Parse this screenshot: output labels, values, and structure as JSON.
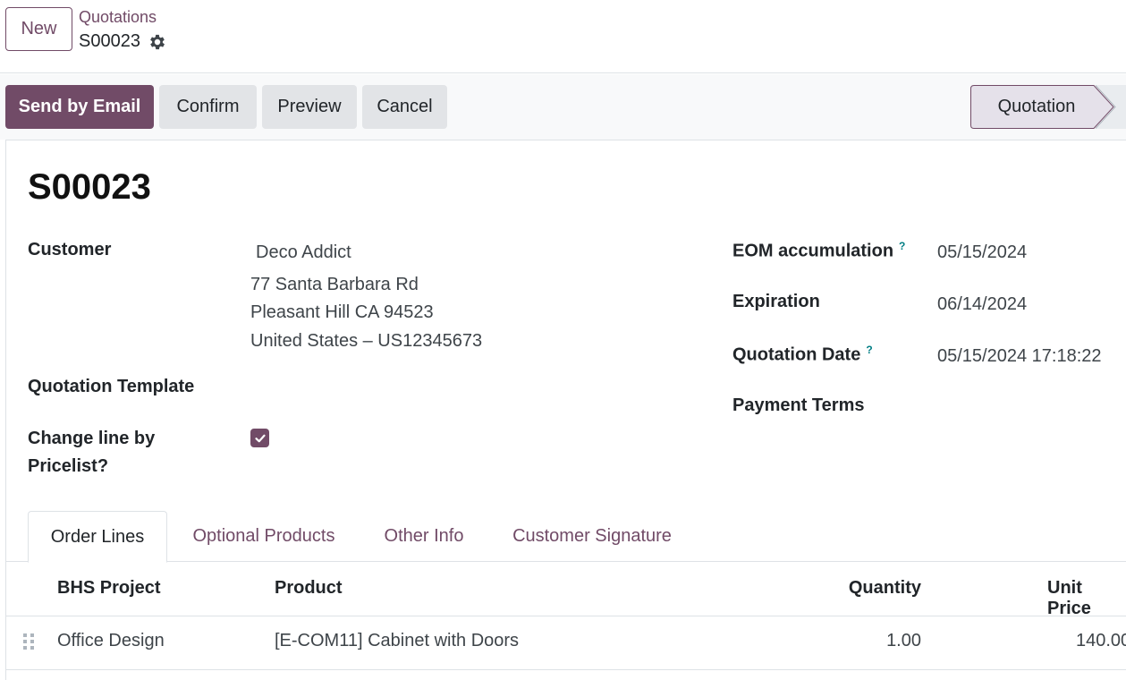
{
  "header": {
    "new_label": "New",
    "breadcrumb_parent": "Quotations",
    "breadcrumb_current": "S00023"
  },
  "actions": {
    "send_email": "Send by Email",
    "confirm": "Confirm",
    "preview": "Preview",
    "cancel": "Cancel"
  },
  "status": {
    "current": "Quotation"
  },
  "record": {
    "name": "S00023",
    "customer_label": "Customer",
    "customer_name": "Deco Addict",
    "address_line1": "77 Santa Barbara Rd",
    "address_line2": "Pleasant Hill CA 94523",
    "address_line3": "United States – US12345673",
    "template_label": "Quotation Template",
    "pricelist_label_1": "Change line by",
    "pricelist_label_2": "Pricelist?",
    "pricelist_checked": true,
    "eom_label": "EOM accumulation",
    "eom_value": "05/15/2024",
    "expiration_label": "Expiration",
    "expiration_value": "06/14/2024",
    "quotation_date_label": "Quotation Date",
    "quotation_date_value": "05/15/2024 17:18:22",
    "payment_terms_label": "Payment Terms",
    "help_mark": "?"
  },
  "tabs": [
    {
      "label": "Order Lines",
      "active": true
    },
    {
      "label": "Optional Products",
      "active": false
    },
    {
      "label": "Other Info",
      "active": false
    },
    {
      "label": "Customer Signature",
      "active": false
    }
  ],
  "table": {
    "columns": [
      "BHS Project",
      "Product",
      "Quantity",
      "Unit Price"
    ],
    "rows": [
      {
        "project": "Office Design",
        "product": "[E-COM11] Cabinet with Doors",
        "quantity": "1.00",
        "unit_price": "140.00"
      }
    ]
  },
  "colors": {
    "brand": "#714b67",
    "help": "#017e84"
  }
}
